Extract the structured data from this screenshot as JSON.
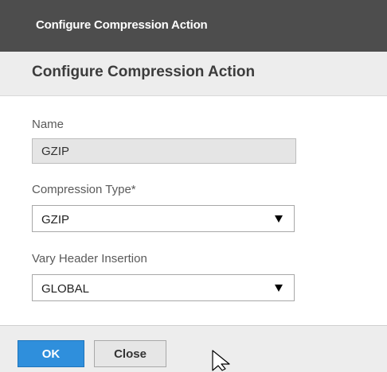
{
  "dialog": {
    "window_title": "Configure Compression Action",
    "header_title": "Configure Compression Action"
  },
  "form": {
    "name": {
      "label": "Name",
      "value": "GZIP"
    },
    "compression_type": {
      "label": "Compression Type*",
      "selected": "GZIP"
    },
    "vary_header_insertion": {
      "label": "Vary Header Insertion",
      "selected": "GLOBAL"
    }
  },
  "buttons": {
    "ok_label": "OK",
    "close_label": "Close"
  },
  "colors": {
    "titlebar": "#4d4d4d",
    "header": "#ededed",
    "primary_button": "#2f8fdc"
  }
}
